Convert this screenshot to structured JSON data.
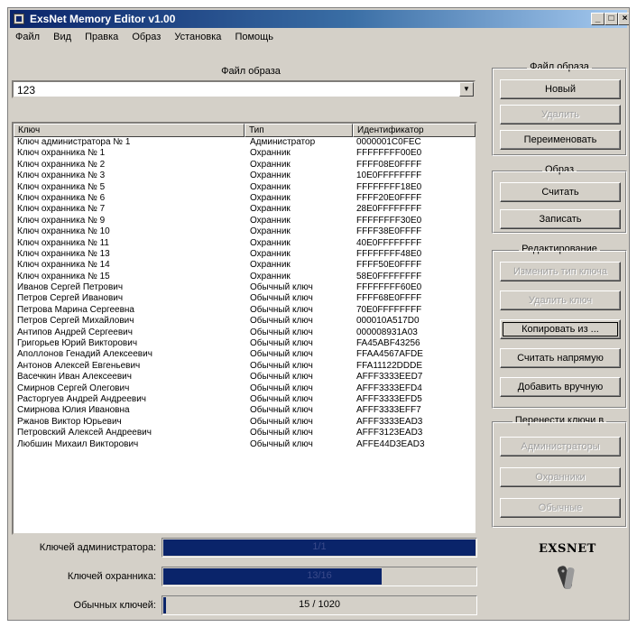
{
  "window": {
    "title": "ExsNet Memory Editor v1.00"
  },
  "menu": [
    "Файл",
    "Вид",
    "Правка",
    "Образ",
    "Установка",
    "Помощь"
  ],
  "image_file": {
    "label": "Файл образа",
    "value": "123"
  },
  "table": {
    "headers": [
      "Ключ",
      "Тип",
      "Идентификатор"
    ],
    "rows": [
      [
        "Ключ администратора № 1",
        "Администратор",
        "0000001C0FEC"
      ],
      [
        "Ключ охранника № 1",
        "Охранник",
        "FFFFFFFF00E0"
      ],
      [
        "Ключ охранника № 2",
        "Охранник",
        "FFFF08E0FFFF"
      ],
      [
        "Ключ охранника № 3",
        "Охранник",
        "10E0FFFFFFFF"
      ],
      [
        "Ключ охранника № 5",
        "Охранник",
        "FFFFFFFF18E0"
      ],
      [
        "Ключ охранника № 6",
        "Охранник",
        "FFFF20E0FFFF"
      ],
      [
        "Ключ охранника № 7",
        "Охранник",
        "28E0FFFFFFFF"
      ],
      [
        "Ключ охранника № 9",
        "Охранник",
        "FFFFFFFF30E0"
      ],
      [
        "Ключ охранника № 10",
        "Охранник",
        "FFFF38E0FFFF"
      ],
      [
        "Ключ охранника № 11",
        "Охранник",
        "40E0FFFFFFFF"
      ],
      [
        "Ключ охранника № 13",
        "Охранник",
        "FFFFFFFF48E0"
      ],
      [
        "Ключ охранника № 14",
        "Охранник",
        "FFFF50E0FFFF"
      ],
      [
        "Ключ охранника № 15",
        "Охранник",
        "58E0FFFFFFFF"
      ],
      [
        "Иванов Сергей Петрович",
        "Обычный ключ",
        "FFFFFFFF60E0"
      ],
      [
        "Петров Сергей Иванович",
        "Обычный ключ",
        "FFFF68E0FFFF"
      ],
      [
        "Петрова Марина Сергеевна",
        "Обычный ключ",
        "70E0FFFFFFFF"
      ],
      [
        "Петров Сергей Михайлович",
        "Обычный ключ",
        "000010A517D0"
      ],
      [
        "Антипов Андрей Сергеевич",
        "Обычный ключ",
        "000008931A03"
      ],
      [
        "Григорьев Юрий Викторович",
        "Обычный ключ",
        "FA45ABF43256"
      ],
      [
        "Аполлонов Генадий Алексеевич",
        "Обычный ключ",
        "FFAA4567AFDE"
      ],
      [
        "Антонов Алексей Евгеньевич",
        "Обычный ключ",
        "FFA11122DDDE"
      ],
      [
        "Васечкин Иван Алексеевич",
        "Обычный ключ",
        "AFFF3333EED7"
      ],
      [
        "Смирнов Сергей Олегович",
        "Обычный ключ",
        "AFFF3333EFD4"
      ],
      [
        "Расторгуев Андрей Андреевич",
        "Обычный ключ",
        "AFFF3333EFD5"
      ],
      [
        "Смирнова Юлия Ивановна",
        "Обычный ключ",
        "AFFF3333EFF7"
      ],
      [
        "Ржанов Виктор Юрьевич",
        "Обычный ключ",
        "AFFF3333EAD3"
      ],
      [
        "Петровский Алексей Андреевич",
        "Обычный ключ",
        "AFFF3123EAD3"
      ],
      [
        "Любшин Михаил Викторович",
        "Обычный ключ",
        "AFFE44D3EAD3"
      ]
    ]
  },
  "groups": {
    "file": {
      "title": "Файл образа",
      "new": "Новый",
      "delete": "Удалить",
      "rename": "Переименовать"
    },
    "image": {
      "title": "Образ",
      "read": "Считать",
      "write": "Записать"
    },
    "edit": {
      "title": "Редактирование",
      "change_type": "Изменить тип ключа",
      "delete_key": "Удалить ключ",
      "copy_from": "Копировать из ...",
      "read_direct": "Считать напрямую",
      "add_manual": "Добавить вручную"
    },
    "move": {
      "title": "Перенести ключи в",
      "admins": "Администраторы",
      "guards": "Охранники",
      "regular": "Обычные"
    }
  },
  "counters": [
    {
      "label": "Ключей администратора:",
      "text": "1/1",
      "fraction": 1.0
    },
    {
      "label": "Ключей охранника:",
      "text": "13/16",
      "fraction": 0.7
    },
    {
      "label": "Обычных ключей:",
      "text": "15 / 1020",
      "fraction": 0.0147
    }
  ],
  "logo": {
    "text": "EXSNET"
  },
  "colors": {
    "face": "#d4d0c8",
    "title_dark": "#0a246a",
    "progress": "#0a246a"
  },
  "icons": [
    "app-icon",
    "minimize-icon",
    "maximize-icon",
    "close-icon",
    "dropdown-arrow-icon",
    "key-fob-icon"
  ]
}
